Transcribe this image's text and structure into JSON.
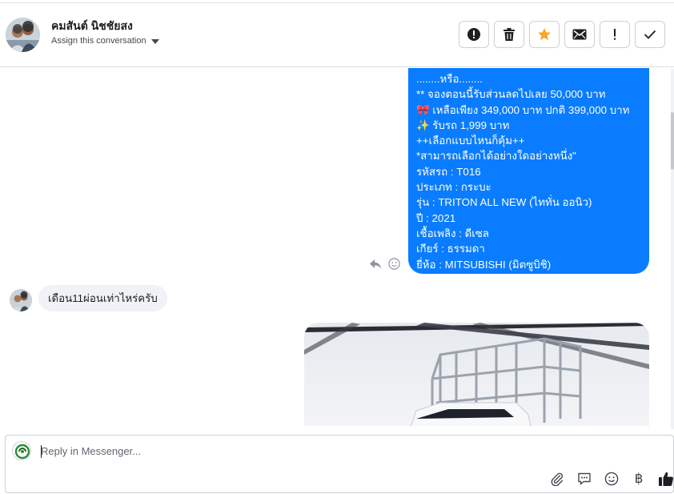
{
  "header": {
    "contact_name": "คมสันต์ นิชชัยสง",
    "assign_label": "Assign this conversation",
    "actions": [
      {
        "name": "spam-button",
        "icon": "alert-circle-icon"
      },
      {
        "name": "delete-button",
        "icon": "trash-icon"
      },
      {
        "name": "star-button",
        "icon": "star-icon"
      },
      {
        "name": "mark-unread-button",
        "icon": "envelope-icon"
      },
      {
        "name": "follow-up-button",
        "icon": "exclamation-icon"
      },
      {
        "name": "mark-done-button",
        "icon": "check-icon"
      }
    ]
  },
  "messages": {
    "outgoing_lines": [
      "........หรือ........",
      "** จองตอนนี้รับส่วนลดไปเลย 50,000 บาท",
      "🎀 เหลือเพียง 349,000 บาท ปกติ 399,000 บาท",
      "✨ รับรถ 1,999 บาท",
      "++เลือกแบบไหนก็คุ้ม++",
      "*สามารถเลือกได้อย่างใดอย่างหนึ่ง\"",
      "รหัสรถ : T016",
      "ประเภท : กระบะ",
      "รุ่น : TRITON ALL NEW (ไททั่น ออนิว)",
      "ปี : 2021",
      "เชื้อเพลิง : ดีเซล",
      "เกียร์ : ธรรมดา",
      "ยี่ห้อ : MITSUBISHI (มิตซูบิชิ)"
    ],
    "incoming_text": "เดือน11ผ่อนเท่าไหร่ครับ"
  },
  "composer": {
    "placeholder": "Reply in Messenger...",
    "baht_symbol": "฿"
  },
  "colors": {
    "outgoing_bubble": "#0a7cff",
    "incoming_bubble": "#f0f2f5",
    "star": "#f5a623"
  }
}
